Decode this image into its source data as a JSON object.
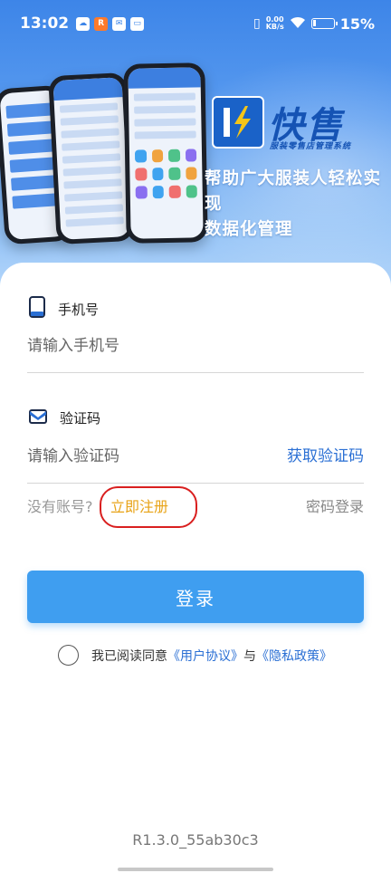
{
  "status_bar": {
    "time": "13:02",
    "net_speed_value": "0.00",
    "net_speed_unit": "KB/s",
    "battery": "15%",
    "battery_level": 0.15
  },
  "banner": {
    "logo_text": "快售",
    "logo_subtitle": "服装零售店管理系统",
    "slogan_line1": "帮助广大服装人轻松实现",
    "slogan_line2": "数据化管理"
  },
  "form": {
    "phone_label": "手机号",
    "phone_placeholder": "请输入手机号",
    "code_label": "验证码",
    "code_placeholder": "请输入验证码",
    "get_code": "获取验证码",
    "no_account": "没有账号?",
    "register": "立即注册",
    "password_login": "密码登录",
    "login_button": "登录"
  },
  "agreement": {
    "prefix": "我已阅读同意",
    "user_agreement": "《用户协议》",
    "and": "与",
    "privacy_policy": "《隐私政策》"
  },
  "version": "R1.3.0_55ab30c3",
  "colors": {
    "primary": "#3f9ef0",
    "link": "#2a6fd4",
    "register": "#e8a317",
    "highlight_circle": "#d91f1f"
  }
}
